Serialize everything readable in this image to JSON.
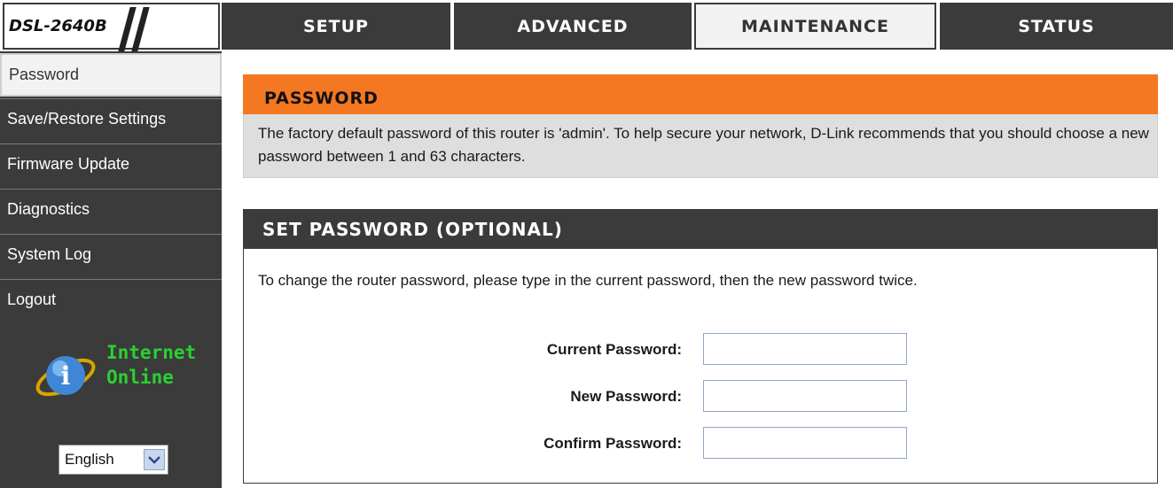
{
  "header": {
    "model": "DSL-2640B",
    "tabs": [
      {
        "label": "SETUP",
        "active": false
      },
      {
        "label": "ADVANCED",
        "active": false
      },
      {
        "label": "MAINTENANCE",
        "active": true
      },
      {
        "label": "STATUS",
        "active": false
      }
    ]
  },
  "sidebar": {
    "items": [
      {
        "label": "Password",
        "active": true
      },
      {
        "label": "Save/Restore Settings",
        "active": false
      },
      {
        "label": "Firmware Update",
        "active": false
      },
      {
        "label": "Diagnostics",
        "active": false
      },
      {
        "label": "System Log",
        "active": false
      },
      {
        "label": "Logout",
        "active": false
      }
    ],
    "status": {
      "line1": "Internet",
      "line2": "Online",
      "icon": "info-globe-icon",
      "color": "#29d130"
    },
    "language": {
      "selected": "English"
    }
  },
  "password_section": {
    "title": "PASSWORD",
    "description": "The factory default password of this router is 'admin'. To help secure your network, D-Link recommends that you should choose a new password between 1 and 63 characters."
  },
  "set_password_section": {
    "title": "SET PASSWORD (OPTIONAL)",
    "instructions": "To change the router password, please type in the current password, then the new password twice.",
    "fields": [
      {
        "label": "Current Password:",
        "value": ""
      },
      {
        "label": "New Password:",
        "value": ""
      },
      {
        "label": "Confirm Password:",
        "value": ""
      }
    ]
  },
  "colors": {
    "accent": "#f47722",
    "nav_dark": "#3b3b3b",
    "status_green": "#29d130"
  }
}
